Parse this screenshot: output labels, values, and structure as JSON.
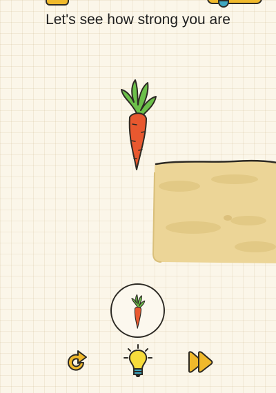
{
  "level": {
    "prompt": "Let's see how strong you are"
  },
  "scene": {
    "draggable_item": "carrot",
    "obstacle": "hay-bale"
  },
  "inventory": {
    "items": [
      "carrot"
    ]
  },
  "controls": {
    "restart_icon": "restart-icon",
    "hint_icon": "lightbulb-icon",
    "skip_icon": "fast-forward-icon"
  },
  "colors": {
    "background": "#fbf6e9",
    "carrot": "#e8582f",
    "leaves": "#6cc04a",
    "hay": "#ecd597",
    "button_yellow": "#f0b92b"
  }
}
